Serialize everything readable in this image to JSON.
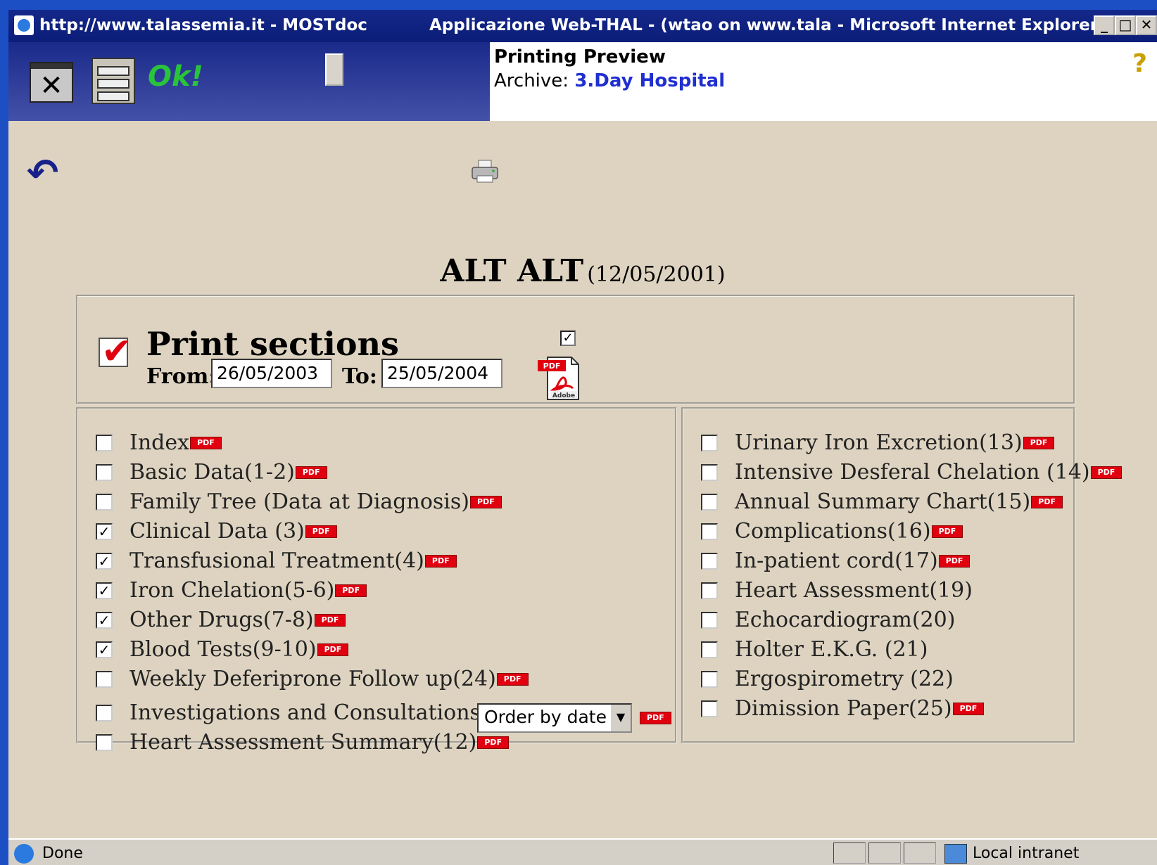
{
  "window": {
    "url_title": "http://www.talassemia.it - MOSTdoc",
    "app_title": "Applicazione Web-THAL - (wtao on www.tala - Microsoft Internet Explorer",
    "minimize": "_",
    "maximize": "□",
    "close": "✕"
  },
  "toolbar": {
    "close_icon": "✕",
    "ok_label": "Ok!",
    "preview_title": "Printing Preview",
    "archive_label": "Archive:",
    "archive_value": "3.Day Hospital",
    "help_icon": "?"
  },
  "back_icon": "↶",
  "patient": {
    "name": "ALT ALT",
    "date": "(12/05/2001)"
  },
  "print": {
    "big_check": "✔",
    "title": "Print sections",
    "from_label": "From:",
    "from_value": "26/05/2003",
    "to_label": "To:",
    "to_value": "25/05/2004",
    "pdf_all_checked": "✓"
  },
  "pdf_label": "PDF",
  "order_select": "Order by date",
  "sections_left": [
    {
      "label": "Index",
      "checked": "",
      "pdf": "PDF"
    },
    {
      "label": "Basic Data(1-2)",
      "checked": "",
      "pdf": "PDF"
    },
    {
      "label": "Family Tree (Data at Diagnosis)",
      "checked": "",
      "pdf": "PDF"
    },
    {
      "label": "Clinical Data (3)",
      "checked": "✓",
      "pdf": "PDF"
    },
    {
      "label": "Transfusional Treatment(4)",
      "checked": "✓",
      "pdf": "PDF"
    },
    {
      "label": "Iron Chelation(5-6)",
      "checked": "✓",
      "pdf": "PDF"
    },
    {
      "label": "Other Drugs(7-8)",
      "checked": "✓",
      "pdf": "PDF"
    },
    {
      "label": "Blood Tests(9-10)",
      "checked": "✓",
      "pdf": "PDF"
    },
    {
      "label": "Weekly Deferiprone Follow up(24)",
      "checked": "",
      "pdf": "PDF"
    },
    {
      "label": "Investigations and Consultations(11)",
      "checked": "",
      "pdf": ""
    },
    {
      "label": "Heart Assessment Summary(12)",
      "checked": "",
      "pdf": "PDF"
    }
  ],
  "sections_right": [
    {
      "label": "Urinary Iron Excretion(13)",
      "checked": "",
      "pdf": "PDF"
    },
    {
      "label": "Intensive Desferal Chelation (14)",
      "checked": "",
      "pdf": "PDF"
    },
    {
      "label": "Annual Summary Chart(15)",
      "checked": "",
      "pdf": "PDF"
    },
    {
      "label": "Complications(16)",
      "checked": "",
      "pdf": "PDF"
    },
    {
      "label": "In-patient cord(17)",
      "checked": "",
      "pdf": "PDF"
    },
    {
      "label": "Heart Assessment(19)",
      "checked": "",
      "pdf": ""
    },
    {
      "label": "Echocardiogram(20)",
      "checked": "",
      "pdf": ""
    },
    {
      "label": "Holter E.K.G. (21)",
      "checked": "",
      "pdf": ""
    },
    {
      "label": "Ergospirometry (22)",
      "checked": "",
      "pdf": ""
    },
    {
      "label": "Dimission Paper(25)",
      "checked": "",
      "pdf": "PDF"
    }
  ],
  "status": {
    "text": "Done",
    "zone": "Local intranet"
  }
}
